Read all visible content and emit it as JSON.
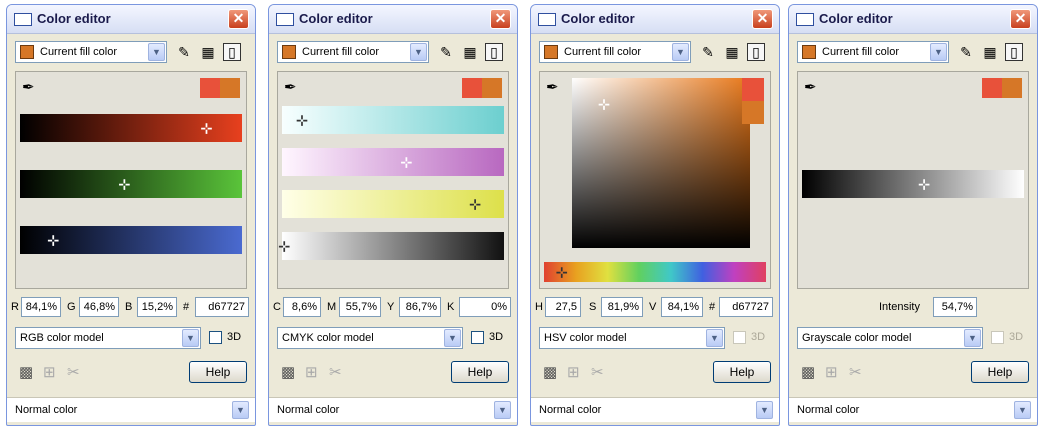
{
  "window_title": "Color editor",
  "close_glyph": "✕",
  "fill_select_label": "Current fill color",
  "colors": {
    "current": "#d67727",
    "previous": "#e8513a"
  },
  "icons": [
    "eyedropper-icon",
    "tag-icon",
    "grid-icon",
    "page-icon",
    "checker-icon",
    "add-row-icon",
    "paint-icon"
  ],
  "help_label": "Help",
  "three_d_label": "3D",
  "normal_color_label": "Normal color",
  "panels": {
    "rgb": {
      "model": "RGB color model",
      "fields": [
        {
          "label": "R",
          "value": "84,1%"
        },
        {
          "label": "G",
          "value": "46,8%"
        },
        {
          "label": "B",
          "value": "15,2%"
        },
        {
          "label": "#",
          "value": "d67727"
        }
      ]
    },
    "cmyk": {
      "model": "CMYK color model",
      "fields": [
        {
          "label": "C",
          "value": "8,6%"
        },
        {
          "label": "M",
          "value": "55,7%"
        },
        {
          "label": "Y",
          "value": "86,7%"
        },
        {
          "label": "K",
          "value": "0%"
        }
      ]
    },
    "hsv": {
      "model": "HSV color model",
      "fields": [
        {
          "label": "H",
          "value": "27,5"
        },
        {
          "label": "S",
          "value": "81,9%"
        },
        {
          "label": "V",
          "value": "84,1%"
        },
        {
          "label": "#",
          "value": "d67727"
        }
      ]
    },
    "gray": {
      "model": "Grayscale color model",
      "intensity_label": "Intensity",
      "intensity_value": "54,7%"
    }
  }
}
